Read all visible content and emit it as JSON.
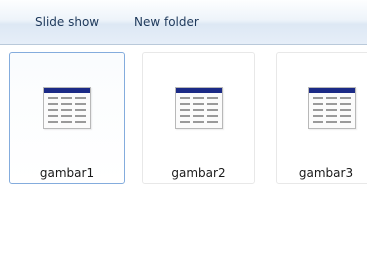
{
  "toolbar": {
    "slide_show_label": "Slide show",
    "new_folder_label": "New folder"
  },
  "files": [
    {
      "name": "gambar1",
      "selected": true,
      "icon": "spreadsheet-thumbnail-icon"
    },
    {
      "name": "gambar2",
      "selected": false,
      "icon": "spreadsheet-thumbnail-icon"
    },
    {
      "name": "gambar3",
      "selected": false,
      "icon": "spreadsheet-thumbnail-icon"
    }
  ],
  "colors": {
    "toolbar_text": "#1e395b",
    "selection_border": "#84acdd",
    "thumbnail_header": "#1b2a86"
  }
}
